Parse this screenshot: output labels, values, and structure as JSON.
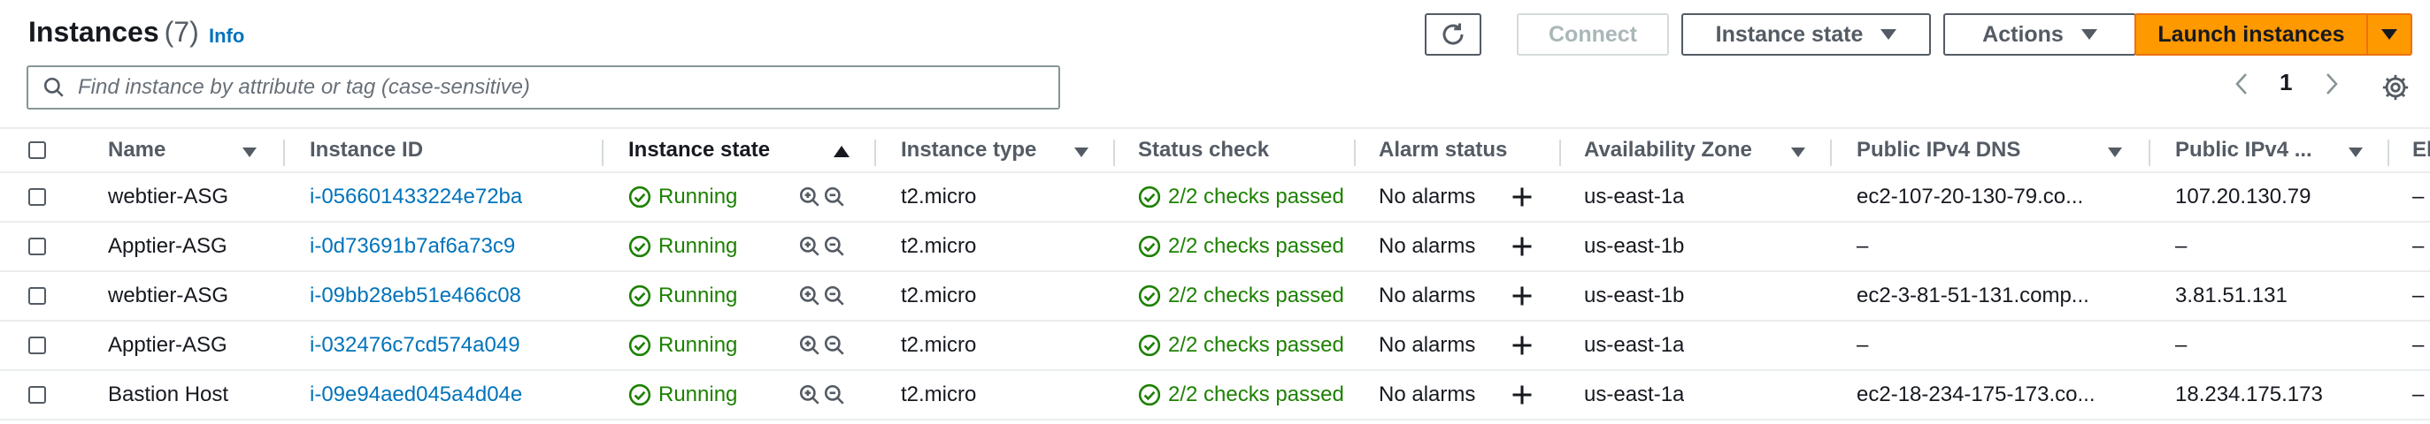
{
  "header": {
    "title": "Instances",
    "count": "(7)",
    "info": "Info"
  },
  "toolbar": {
    "connect_label": "Connect",
    "instance_state_label": "Instance state",
    "actions_label": "Actions",
    "launch_label": "Launch instances"
  },
  "search": {
    "placeholder": "Find instance by attribute or tag (case-sensitive)"
  },
  "pagination": {
    "page": "1"
  },
  "table": {
    "headers": {
      "name": "Name",
      "instance_id": "Instance ID",
      "instance_state": "Instance state",
      "instance_type": "Instance type",
      "status_check": "Status check",
      "alarm_status": "Alarm status",
      "availability_zone": "Availability Zone",
      "public_dns": "Public IPv4 DNS",
      "public_ip": "Public IPv4 ...",
      "elastic": "El"
    },
    "rows": [
      {
        "name": "webtier-ASG",
        "id": "i-056601433224e72ba",
        "state": "Running",
        "type": "t2.micro",
        "status": "2/2 checks passed",
        "alarm": "No alarms",
        "az": "us-east-1a",
        "dns": "ec2-107-20-130-79.co...",
        "ip": "107.20.130.79",
        "el": "–"
      },
      {
        "name": "Apptier-ASG",
        "id": "i-0d73691b7af6a73c9",
        "state": "Running",
        "type": "t2.micro",
        "status": "2/2 checks passed",
        "alarm": "No alarms",
        "az": "us-east-1b",
        "dns": "–",
        "ip": "–",
        "el": "–"
      },
      {
        "name": "webtier-ASG",
        "id": "i-09bb28eb51e466c08",
        "state": "Running",
        "type": "t2.micro",
        "status": "2/2 checks passed",
        "alarm": "No alarms",
        "az": "us-east-1b",
        "dns": "ec2-3-81-51-131.comp...",
        "ip": "3.81.51.131",
        "el": "–"
      },
      {
        "name": "Apptier-ASG",
        "id": "i-032476c7cd574a049",
        "state": "Running",
        "type": "t2.micro",
        "status": "2/2 checks passed",
        "alarm": "No alarms",
        "az": "us-east-1a",
        "dns": "–",
        "ip": "–",
        "el": "–"
      },
      {
        "name": "Bastion Host",
        "id": "i-09e94aed045a4d04e",
        "state": "Running",
        "type": "t2.micro",
        "status": "2/2 checks passed",
        "alarm": "No alarms",
        "az": "us-east-1a",
        "dns": "ec2-18-234-175-173.co...",
        "ip": "18.234.175.173",
        "el": "–"
      }
    ]
  },
  "colors": {
    "link": "#0073bb",
    "success": "#1d8102",
    "primary": "#ff9900"
  },
  "icons": [
    "refresh-icon",
    "caret-down-icon",
    "search-icon",
    "chevron-left-icon",
    "chevron-right-icon",
    "settings-icon",
    "sort-icon",
    "check-circle-icon",
    "zoom-in-icon",
    "zoom-out-icon",
    "add-icon"
  ]
}
